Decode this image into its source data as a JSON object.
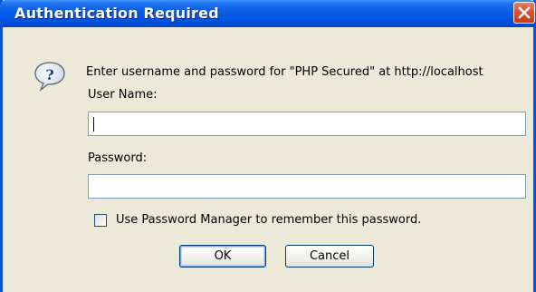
{
  "window": {
    "title": "Authentication Required"
  },
  "icons": {
    "help": "question-speech-icon",
    "close": "close-icon"
  },
  "dialog": {
    "prompt": "Enter username and password for \"PHP Secured\" at http://localhost",
    "username_label": "User Name:",
    "username_value": "",
    "password_label": "Password:",
    "password_value": "",
    "remember_label": "Use Password Manager to remember this password.",
    "remember_checked": false,
    "ok_label": "OK",
    "cancel_label": "Cancel"
  },
  "colors": {
    "titlebar": "#0055e5",
    "frame": "#0054e3",
    "body": "#ece9d8",
    "close": "#d8532d",
    "input_border": "#7f9db9"
  }
}
